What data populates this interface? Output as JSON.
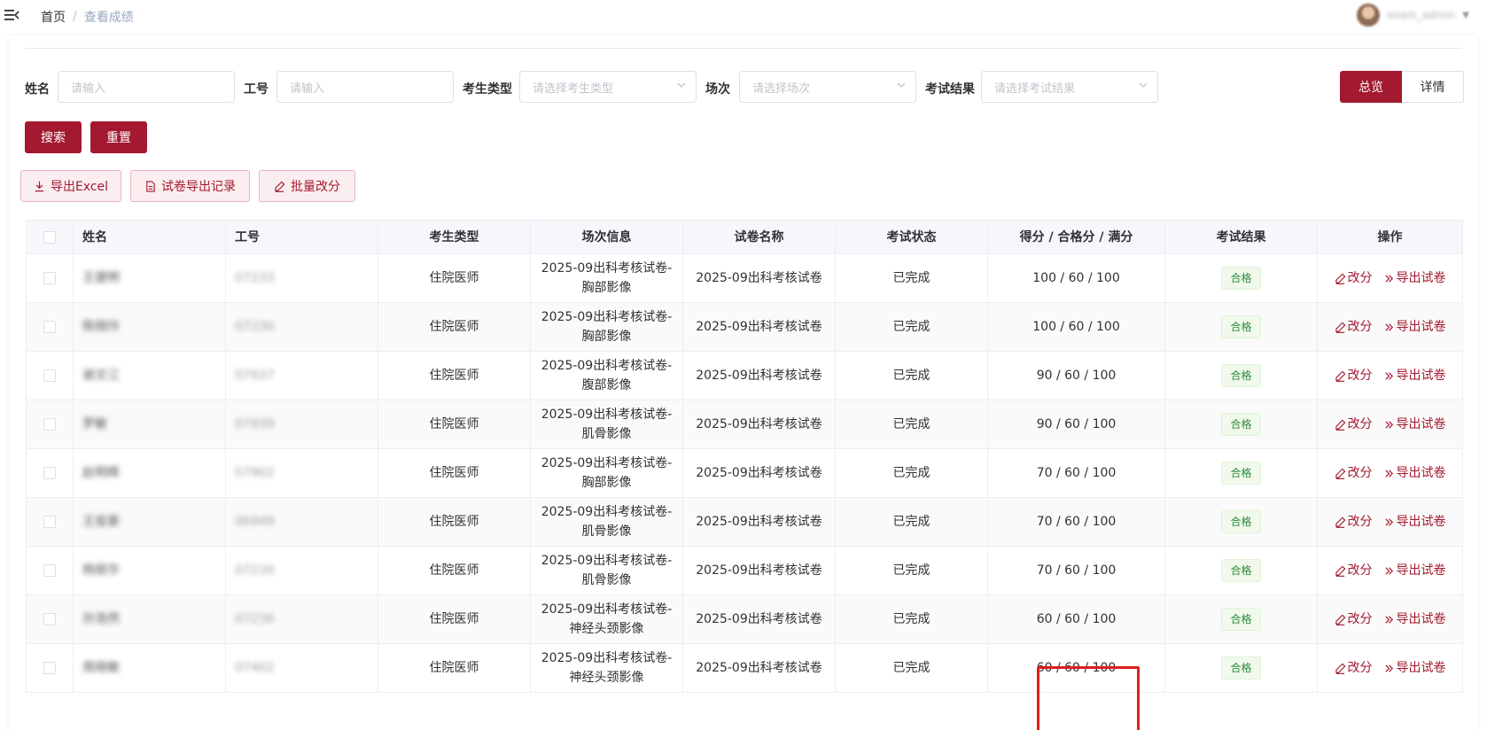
{
  "breadcrumb": {
    "home": "首页",
    "separator": "/",
    "current": "查看成绩"
  },
  "user": {
    "name": "exam_admin"
  },
  "filters": {
    "name_label": "姓名",
    "name_placeholder": "请输入",
    "id_label": "工号",
    "id_placeholder": "请输入",
    "type_label": "考生类型",
    "type_placeholder": "请选择考生类型",
    "session_label": "场次",
    "session_placeholder": "请选择场次",
    "result_label": "考试结果",
    "result_placeholder": "请选择考试结果"
  },
  "view_toggle": {
    "overview": "总览",
    "detail": "详情",
    "active": "overview"
  },
  "actions": {
    "search": "搜索",
    "reset": "重置",
    "export_excel": "导出Excel",
    "export_records": "试卷导出记录",
    "batch_grade": "批量改分"
  },
  "colors": {
    "primary": "#a3192f",
    "pass_tag": "#2f8a3c",
    "highlight": "#e01e1e"
  },
  "table": {
    "headers": {
      "name": "姓名",
      "id": "工号",
      "type": "考生类型",
      "session": "场次信息",
      "paper": "试卷名称",
      "status": "考试状态",
      "score": "得分 / 合格分 / 满分",
      "result": "考试结果",
      "ops": "操作"
    },
    "op_edit": "改分",
    "op_export": "导出试卷",
    "rows": [
      {
        "name": "王建明",
        "id": "07233",
        "type": "住院医师",
        "session_line1": "2025-09出科考核试卷-",
        "session_line2": "胸部影像",
        "paper": "2025-09出科考核试卷",
        "status": "已完成",
        "score": "100 / 60 / 100",
        "result": "合格"
      },
      {
        "name": "陈晓玲",
        "id": "07230",
        "type": "住院医师",
        "session_line1": "2025-09出科考核试卷-",
        "session_line2": "胸部影像",
        "paper": "2025-09出科考核试卷",
        "status": "已完成",
        "score": "100 / 60 / 100",
        "result": "合格"
      },
      {
        "name": "谢文江",
        "id": "07937",
        "type": "住院医师",
        "session_line1": "2025-09出科考核试卷-",
        "session_line2": "腹部影像",
        "paper": "2025-09出科考核试卷",
        "status": "已完成",
        "score": "90 / 60 / 100",
        "result": "合格"
      },
      {
        "name": "罗敏",
        "id": "07939",
        "type": "住院医师",
        "session_line1": "2025-09出科考核试卷-",
        "session_line2": "肌骨影像",
        "paper": "2025-09出科考核试卷",
        "status": "已完成",
        "score": "90 / 60 / 100",
        "result": "合格"
      },
      {
        "name": "赵明辉",
        "id": "07902",
        "type": "住院医师",
        "session_line1": "2025-09出科考核试卷-",
        "session_line2": "胸部影像",
        "paper": "2025-09出科考核试卷",
        "status": "已完成",
        "score": "70 / 60 / 100",
        "result": "合格"
      },
      {
        "name": "王俊豪",
        "id": "06949",
        "type": "住院医师",
        "session_line1": "2025-09出科考核试卷-",
        "session_line2": "肌骨影像",
        "paper": "2025-09出科考核试卷",
        "status": "已完成",
        "score": "70 / 60 / 100",
        "result": "合格"
      },
      {
        "name": "杨丽华",
        "id": "07234",
        "type": "住院医师",
        "session_line1": "2025-09出科考核试卷-",
        "session_line2": "肌骨影像",
        "paper": "2025-09出科考核试卷",
        "status": "已完成",
        "score": "70 / 60 / 100",
        "result": "合格"
      },
      {
        "name": "孙浩然",
        "id": "07236",
        "type": "住院医师",
        "session_line1": "2025-09出科考核试卷-",
        "session_line2": "神经头颈影像",
        "paper": "2025-09出科考核试卷",
        "status": "已完成",
        "score": "60 / 60 / 100",
        "result": "合格"
      },
      {
        "name": "周晓敏",
        "id": "07402",
        "type": "住院医师",
        "session_line1": "2025-09出科考核试卷-",
        "session_line2": "神经头颈影像",
        "paper": "2025-09出科考核试卷",
        "status": "已完成",
        "score": "60 / 60 / 100",
        "result": "合格"
      }
    ]
  }
}
